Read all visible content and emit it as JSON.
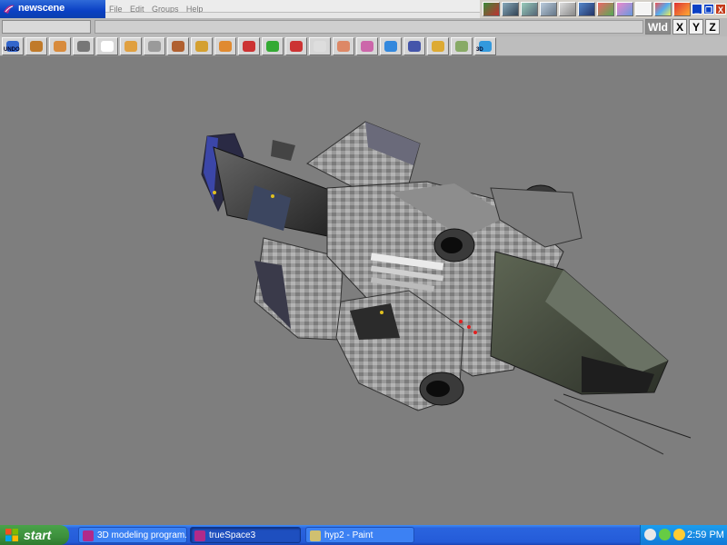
{
  "window": {
    "title": "newscene"
  },
  "menu": [
    "File",
    "Edit",
    "Groups",
    "Help"
  ],
  "top_toolbar_icons": [
    "render-icon",
    "mesh-icon",
    "tree-icon",
    "curve-icon",
    "bones-icon",
    "grid-icon",
    "flower-icon",
    "balls-icon",
    "frame-icon",
    "palette-icon",
    "question-icon"
  ],
  "window_buttons": {
    "minimize": "_",
    "restore": "❐",
    "close": "X"
  },
  "coordinate_buttons": [
    "Wld",
    "X",
    "Y",
    "Z"
  ],
  "tools": [
    {
      "icon": "undo-icon",
      "label": "UNDO",
      "color": "#3366cc"
    },
    {
      "icon": "eye-icon",
      "color": "#c07a2a"
    },
    {
      "icon": "cube-icon",
      "color": "#d88b3c"
    },
    {
      "icon": "camera-icon",
      "color": "#777777"
    },
    {
      "icon": "pointer-icon",
      "color": "#ffffff"
    },
    {
      "icon": "rotate-icon",
      "color": "#e0a040"
    },
    {
      "icon": "home-icon",
      "color": "#9a9a9a"
    },
    {
      "icon": "box-icon",
      "color": "#b06030"
    },
    {
      "icon": "material-icon",
      "color": "#d4a030"
    },
    {
      "icon": "sphere-icon",
      "color": "#e08a30"
    },
    {
      "icon": "color-ball-icon",
      "color": "#cc3333"
    },
    {
      "icon": "blob-icon",
      "color": "#33aa33"
    },
    {
      "icon": "light-icon",
      "color": "#cc3333"
    },
    {
      "icon": "path-icon",
      "color": "#dddddd"
    },
    {
      "icon": "paint-icon",
      "color": "#dd8866"
    },
    {
      "icon": "brush-icon",
      "color": "#cc66aa"
    },
    {
      "icon": "spheres-icon",
      "color": "#3388dd"
    },
    {
      "icon": "grid-icon",
      "color": "#4455aa"
    },
    {
      "icon": "group-icon",
      "color": "#ddaa33"
    },
    {
      "icon": "plane-icon",
      "color": "#88aa66"
    },
    {
      "icon": "3d-icon",
      "label": "3D",
      "color": "#3399dd"
    }
  ],
  "taskbar": {
    "start_label": "start",
    "tasks": [
      {
        "label": "3D modeling program...",
        "active": false
      },
      {
        "label": "trueSpace3",
        "active": true
      },
      {
        "label": "hyp2 - Paint",
        "active": false
      }
    ],
    "clock": "2:59 PM"
  },
  "colors": {
    "viewport_bg": "#7e7e7e",
    "title_blue": "#0a40c4",
    "taskbar_blue": "#245bd8",
    "start_green": "#3c8f3c"
  }
}
